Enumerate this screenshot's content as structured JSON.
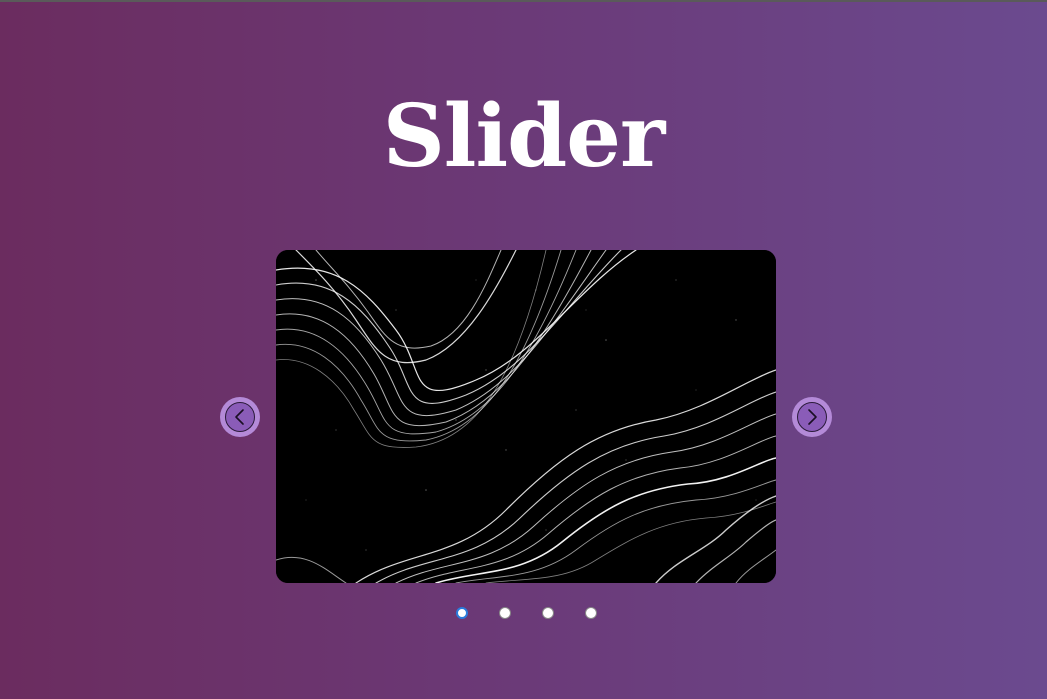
{
  "page": {
    "title": "Slider"
  },
  "slider": {
    "current_index": 0,
    "slide_count": 4,
    "slide_image": "abstract-topographic-wave-lines",
    "prev_icon": "chevron-left-icon",
    "next_icon": "chevron-right-icon",
    "active_dot_color": "#2a7bdc"
  }
}
